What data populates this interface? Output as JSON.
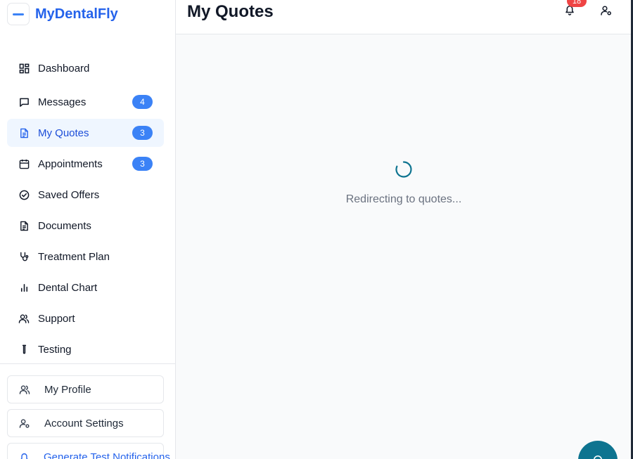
{
  "brand": {
    "name": "MyDentalFly",
    "accent": "#2563eb"
  },
  "sidebar": {
    "items": [
      {
        "label": "Dashboard",
        "icon": "dashboard-icon",
        "badge": ""
      },
      {
        "label": "Messages",
        "icon": "message-icon",
        "badge": "4"
      },
      {
        "label": "My Quotes",
        "icon": "document-icon",
        "badge": "3",
        "active": true
      },
      {
        "label": "Appointments",
        "icon": "calendar-icon",
        "badge": "3"
      },
      {
        "label": "Saved Offers",
        "icon": "check-circle-icon",
        "badge": ""
      },
      {
        "label": "Documents",
        "icon": "file-icon",
        "badge": ""
      },
      {
        "label": "Treatment Plan",
        "icon": "stethoscope-icon",
        "badge": ""
      },
      {
        "label": "Dental Chart",
        "icon": "bar-chart-icon",
        "badge": ""
      },
      {
        "label": "Support",
        "icon": "users-icon",
        "badge": ""
      },
      {
        "label": "Testing",
        "icon": "test-tube-icon",
        "badge": ""
      }
    ],
    "bottom": {
      "profile": "My Profile",
      "settings": "Account Settings",
      "notifications": "Generate Test Notifications"
    }
  },
  "header": {
    "title": "My Quotes",
    "notification_count": "18"
  },
  "main": {
    "loading_text": "Redirecting to quotes...",
    "spinner_color": "#0e7490"
  },
  "colors": {
    "badge": "#3b82f6",
    "notification_badge": "#ef4444",
    "fab": "#0e7490"
  }
}
